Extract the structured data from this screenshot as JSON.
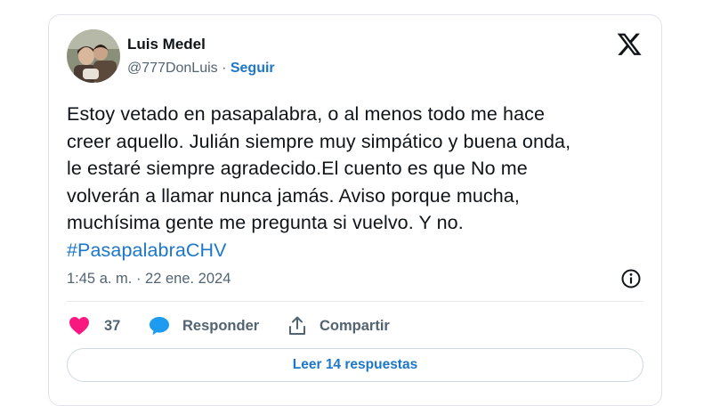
{
  "author": {
    "name": "Luis Medel",
    "handle": "@777DonLuis",
    "separator": " · ",
    "follow_label": "Seguir"
  },
  "tweet": {
    "lines": [
      "Estoy vetado en pasapalabra, o al menos todo me hace",
      "creer aquello. Julián siempre muy simpático y buena onda,",
      "le estaré siempre agradecido.El cuento es que No me",
      "volverán a llamar nunca jamás. Aviso porque mucha,",
      "muchísima gente me pregunta si vuelvo. Y no."
    ],
    "hashtag": "#PasapalabraCHV",
    "timestamp": "1:45 a. m. · 22 ene. 2024"
  },
  "actions": {
    "like_count": "37",
    "reply_label": "Responder",
    "share_label": "Compartir"
  },
  "read_replies_label": "Leer 14 respuestas",
  "colors": {
    "accent": "#1d77c9",
    "like": "#f91880",
    "reply_icon": "#1d9bf0",
    "text": "#0f1419",
    "muted": "#536471"
  },
  "icons": [
    "avatar-photo",
    "x-logo-icon",
    "info-icon",
    "heart-icon",
    "comment-bubble-icon",
    "share-icon"
  ]
}
